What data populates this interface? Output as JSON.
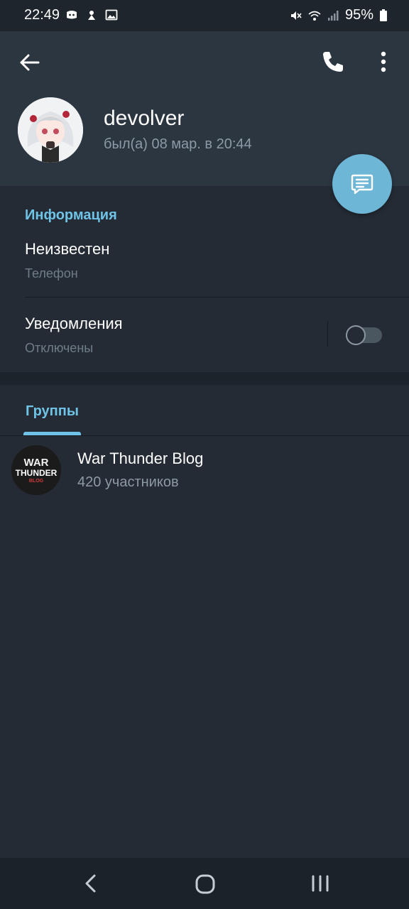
{
  "status_bar": {
    "time": "22:49",
    "battery_percent": "95%",
    "left_icons": [
      "discord-icon",
      "steam-icon",
      "image-icon"
    ],
    "right_icons": [
      "mute-icon",
      "wifi-icon",
      "signal-icon",
      "battery-icon"
    ]
  },
  "header": {
    "back_icon": "arrow-left-icon",
    "call_icon": "phone-icon",
    "menu_icon": "more-vertical-icon"
  },
  "profile": {
    "name": "devolver",
    "last_seen": "был(а) 08 мар. в 20:44"
  },
  "fab": {
    "icon": "message-icon"
  },
  "info": {
    "title": "Информация",
    "phone_value": "Неизвестен",
    "phone_label": "Телефон",
    "notifications_title": "Уведомления",
    "notifications_status": "Отключены",
    "notifications_enabled": false
  },
  "groups": {
    "tab_label": "Группы",
    "items": [
      {
        "name": "War Thunder Blog",
        "members": "420 участников",
        "avatar_text": [
          "WAR",
          "THUNDER",
          "BLOG"
        ]
      }
    ]
  },
  "colors": {
    "accent": "#6fc3e6",
    "fab": "#6db6d6",
    "background": "#242b34",
    "header": "#2c3640"
  }
}
